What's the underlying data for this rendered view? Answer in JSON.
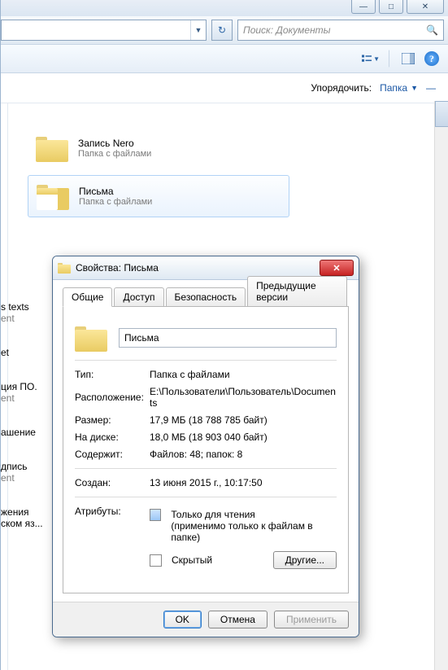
{
  "titlebar": {
    "min": "—",
    "max": "□",
    "close": "✕"
  },
  "nav": {
    "search_placeholder": "Поиск: Документы"
  },
  "subbar": {
    "organize": "Упорядочить:",
    "folder": "Папка",
    "dash": "—"
  },
  "items": [
    {
      "name": "Запись Nero",
      "type": "Папка с файлами"
    },
    {
      "name": "Письма",
      "type": "Папка с файлами"
    }
  ],
  "sidebar_labels": {
    "l1": "s texts",
    "l1s": "ent",
    "l2": "et",
    "l3": "ция ПО.",
    "l3s": "ent",
    "l4": "ашение",
    "l5": "дпись",
    "l5s": "ent",
    "l6": "жения",
    "l6b": "ском яз..."
  },
  "dialog": {
    "title": "Свойства: Письма",
    "tabs": [
      "Общие",
      "Доступ",
      "Безопасность",
      "Предыдущие версии"
    ],
    "name_value": "Письма",
    "rows": {
      "type_l": "Тип:",
      "type_v": "Папка с файлами",
      "loc_l": "Расположение:",
      "loc_v": "E:\\Пользователи\\Пользователь\\Documents",
      "size_l": "Размер:",
      "size_v": "17,9 МБ (18 788 785 байт)",
      "disk_l": "На диске:",
      "disk_v": "18,0 МБ (18 903 040 байт)",
      "cont_l": "Содержит:",
      "cont_v": "Файлов: 48; папок: 8",
      "created_l": "Создан:",
      "created_v": "13 июня 2015 г., 10:17:50",
      "attr_l": "Атрибуты:",
      "ro": "Только для чтения",
      "ro2": "(применимо только к файлам в папке)",
      "hidden": "Скрытый",
      "other": "Другие..."
    },
    "buttons": {
      "ok": "OK",
      "cancel": "Отмена",
      "apply": "Применить"
    }
  }
}
